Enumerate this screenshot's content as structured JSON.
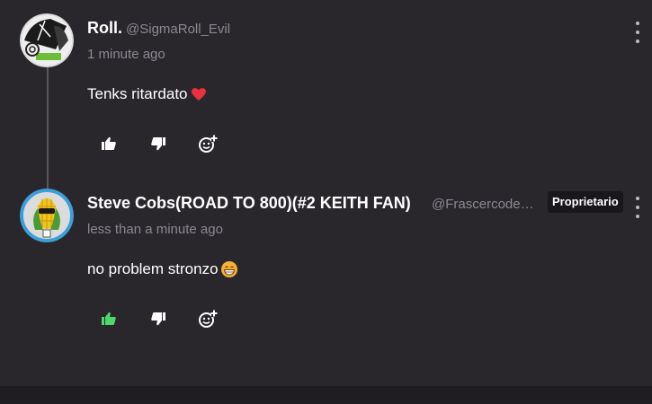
{
  "comments": [
    {
      "username": "Roll.",
      "handle": "@SigmaRoll_Evil",
      "timestamp": "1 minute ago",
      "text": "Tenks ritardato",
      "emoji": "red-heart",
      "liked": false,
      "badge": ""
    },
    {
      "username": "Steve Cobs(ROAD TO 800)(#2 KEITH FAN)",
      "handle": "@Frascercode…",
      "timestamp": "less than a minute ago",
      "text": "no problem stronzo",
      "emoji": "grinning-face",
      "liked": true,
      "badge": "Proprietario"
    }
  ],
  "icons": {
    "like": "thumbs-up-icon",
    "dislike": "thumbs-down-icon",
    "react": "add-reaction-icon",
    "more": "more-options-icon"
  },
  "colors": {
    "background": "#2a272c",
    "liked": "#4fd86a",
    "muted": "#8c8891",
    "heart": "#e8303f"
  }
}
